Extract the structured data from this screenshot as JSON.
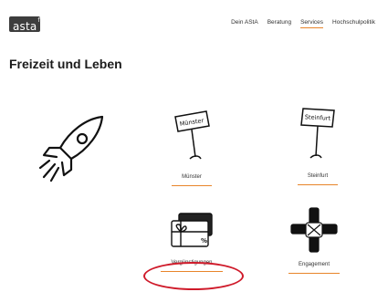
{
  "header": {
    "logo_text": "asta",
    "logo_sup": "fh",
    "nav": [
      {
        "label": "Dein AStA",
        "active": false
      },
      {
        "label": "Beratung",
        "active": false
      },
      {
        "label": "Services",
        "active": true
      },
      {
        "label": "Hochschulpolitik",
        "active": false
      }
    ]
  },
  "main": {
    "title": "Freizeit und Leben",
    "cards": [
      {
        "label": "Münster",
        "sign_text": "Münster",
        "icon": "signpost-icon"
      },
      {
        "label": "Steinfurt",
        "sign_text": "Steinfurt",
        "icon": "signpost-icon"
      },
      {
        "label": "Vergünstigungen",
        "icon": "gift-card-icon",
        "badge": "%"
      },
      {
        "label": "Engagement",
        "icon": "hands-together-icon"
      }
    ]
  },
  "colors": {
    "accent": "#e8852a",
    "highlight": "#cf1a2a"
  }
}
